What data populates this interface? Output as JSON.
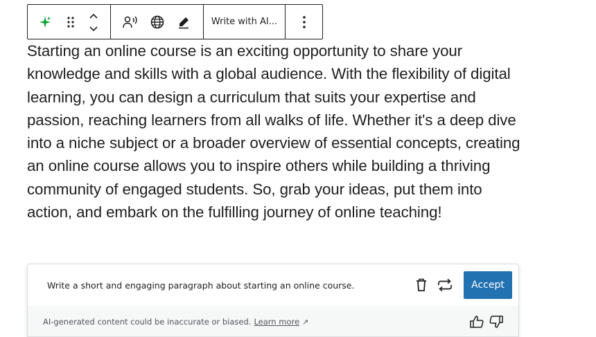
{
  "toolbar": {
    "ai_sparkle_icon": "sparkle-icon",
    "drag_icon": "drag-handle-icon",
    "move_up_icon": "chevron-up-icon",
    "move_down_icon": "chevron-down-icon",
    "text_to_speech_icon": "speech-icon",
    "translate_icon": "globe-icon",
    "edit_icon": "pen-icon",
    "write_with_ai_label": "Write with AI...",
    "options_icon": "more-vertical-icon"
  },
  "content": {
    "paragraph": "Starting an online course is an exciting opportunity to share your knowledge and skills with a global audience. With the flexibility of digital learning, you can design a curriculum that suits your expertise and passion, reaching learners from all walks of life. Whether it's a deep dive into a niche subject or a broader overview of essential concepts, creating an online course allows you to inspire others while building a thriving community of engaged students. So, grab your ideas, put them into action, and embark on the fulfilling journey of online teaching!"
  },
  "ai_panel": {
    "prompt": "Write a short and engaging paragraph about starting an online course.",
    "accept_label": "Accept",
    "disclaimer": "AI-generated content could be inaccurate or biased.",
    "learn_more_label": "Learn more",
    "external_arrow": "↗"
  },
  "colors": {
    "accent": "#2271b1",
    "sparkle": "#00a32a",
    "text": "#1e1e1e",
    "muted": "#50575e"
  }
}
